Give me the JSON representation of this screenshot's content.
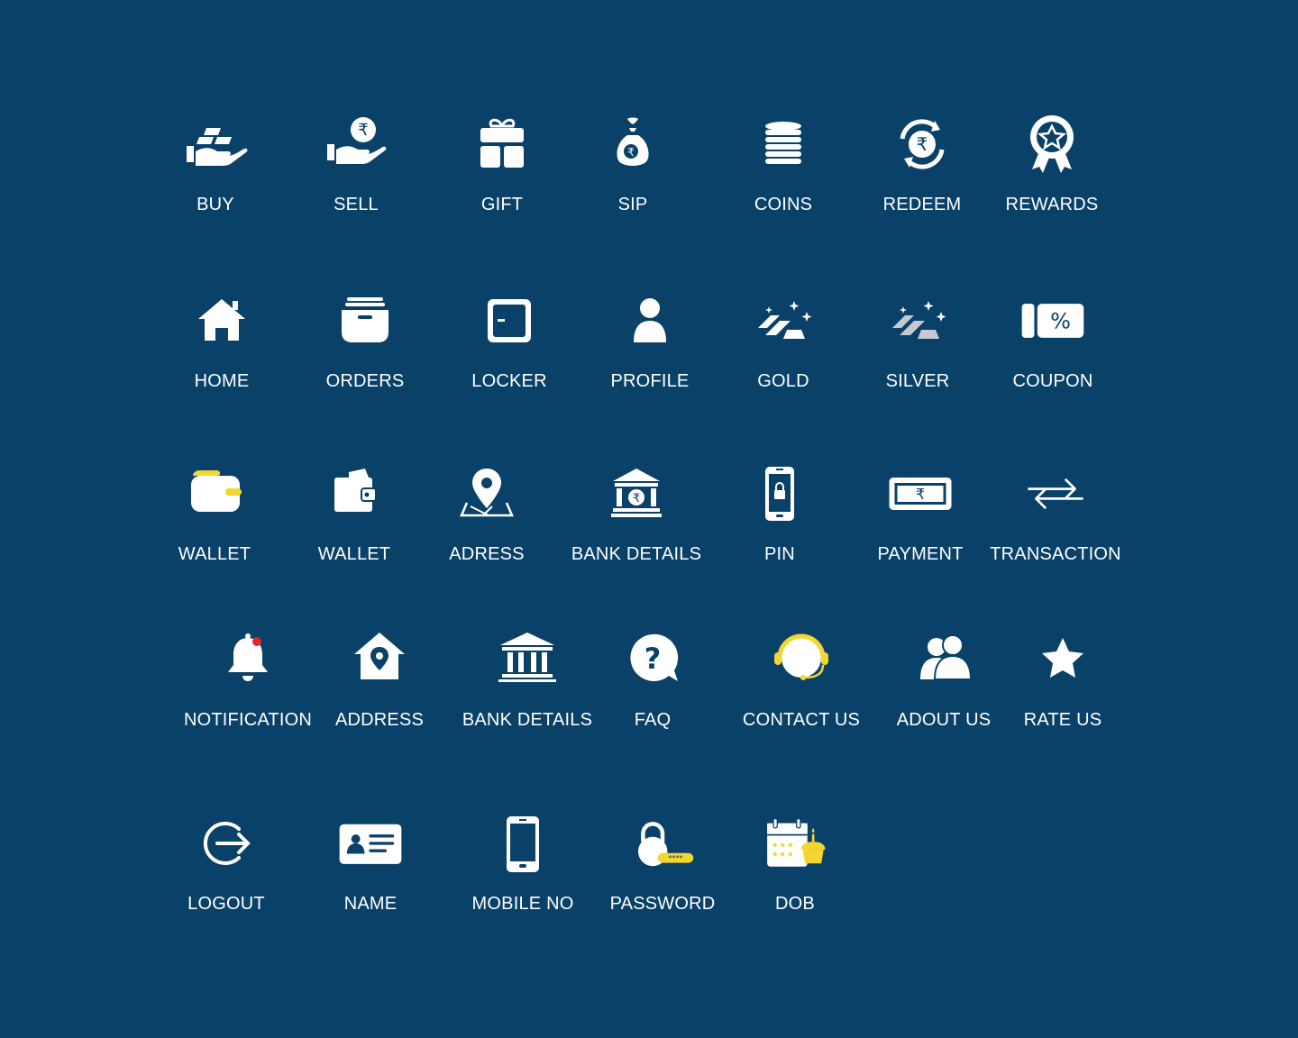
{
  "colors": {
    "background": "#0a4168",
    "icon": "#ffffff",
    "accent_yellow": "#f5d630",
    "accent_red": "#e3262b",
    "silver": "#c6cad0"
  },
  "rows": [
    [
      {
        "label": "BUY",
        "icon": "gold-bars-hand-icon"
      },
      {
        "label": "SELL",
        "icon": "rupee-hand-icon"
      },
      {
        "label": "GIFT",
        "icon": "gift-icon"
      },
      {
        "label": "SIP",
        "icon": "money-bag-icon"
      },
      {
        "label": "COINS",
        "icon": "coins-stack-icon"
      },
      {
        "label": "REDEEM",
        "icon": "rupee-cycle-icon"
      },
      {
        "label": "REWARDS",
        "icon": "badge-star-icon"
      }
    ],
    [
      {
        "label": "HOME",
        "icon": "home-icon"
      },
      {
        "label": "ORDERS",
        "icon": "orders-box-icon"
      },
      {
        "label": "LOCKER",
        "icon": "locker-icon"
      },
      {
        "label": "PROFILE",
        "icon": "profile-icon"
      },
      {
        "label": "GOLD",
        "icon": "gold-bars-icon"
      },
      {
        "label": "SILVER",
        "icon": "silver-bars-icon"
      },
      {
        "label": "COUPON",
        "icon": "coupon-icon"
      }
    ],
    [
      {
        "label": "WALLET",
        "icon": "wallet-yellow-icon"
      },
      {
        "label": "WALLET",
        "icon": "wallet-icon"
      },
      {
        "label": "ADRESS",
        "icon": "map-pin-icon"
      },
      {
        "label": "BANK DETAILS",
        "icon": "bank-rupee-icon"
      },
      {
        "label": "PIN",
        "icon": "phone-lock-icon"
      },
      {
        "label": "PAYMENT",
        "icon": "banknote-icon"
      },
      {
        "label": "TRANSACTION",
        "icon": "transfer-arrows-icon"
      }
    ],
    [
      {
        "label": "NOTIFICATION",
        "icon": "bell-icon"
      },
      {
        "label": "ADDRESS",
        "icon": "home-pin-icon"
      },
      {
        "label": "BANK DETAILS",
        "icon": "bank-columns-icon"
      },
      {
        "label": "FAQ",
        "icon": "question-bubble-icon"
      },
      {
        "label": "CONTACT US",
        "icon": "headset-icon"
      },
      {
        "label": "ADOUT US",
        "icon": "users-icon"
      },
      {
        "label": "RATE US",
        "icon": "star-icon"
      }
    ],
    [
      {
        "label": "LOGOUT",
        "icon": "logout-icon"
      },
      {
        "label": "NAME",
        "icon": "id-card-icon"
      },
      {
        "label": "MOBILE NO",
        "icon": "mobile-icon"
      },
      {
        "label": "PASSWORD",
        "icon": "padlock-password-icon"
      },
      {
        "label": "DOB",
        "icon": "calendar-cake-icon"
      }
    ]
  ]
}
